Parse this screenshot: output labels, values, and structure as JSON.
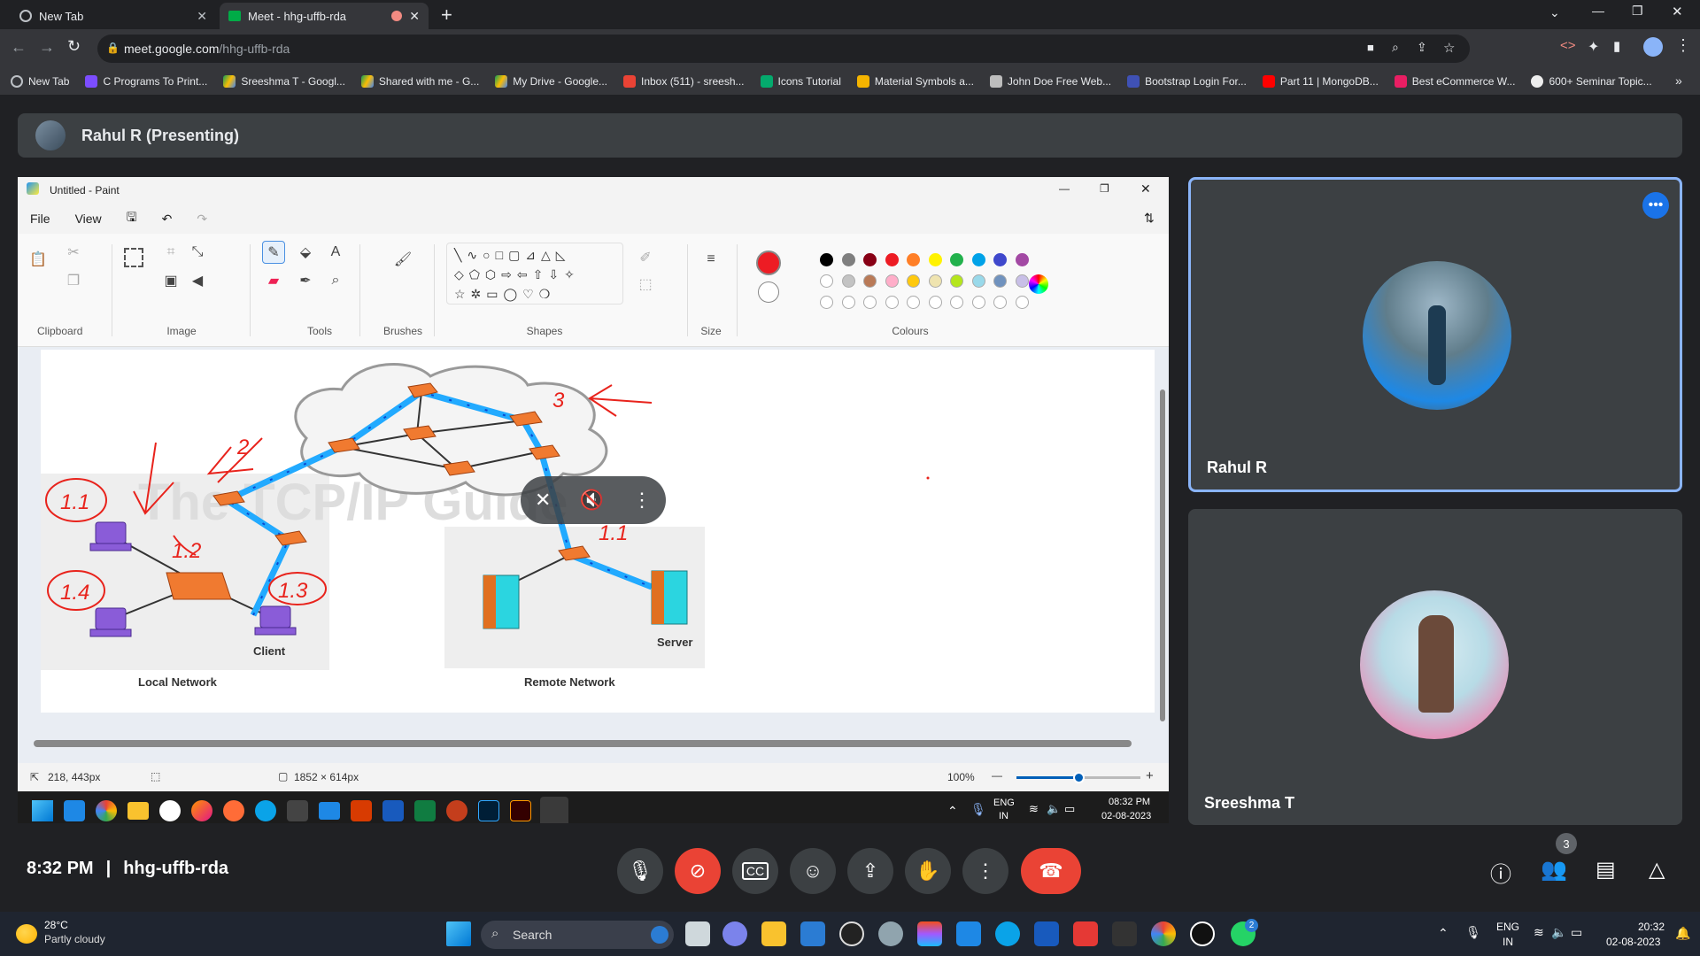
{
  "browser": {
    "tabs": [
      {
        "title": "New Tab",
        "active": false
      },
      {
        "title": "Meet - hhg-uffb-rda",
        "active": true
      }
    ],
    "url_host": "meet.google.com",
    "url_path": "/hhg-uffb-rda",
    "bookmarks": [
      "New Tab",
      "C Programs To Print...",
      "Sreeshma T - Googl...",
      "Shared with me - G...",
      "My Drive - Google...",
      "Inbox (511) - sreesh...",
      "Icons Tutorial",
      "Material Symbols a...",
      "John Doe Free Web...",
      "Bootstrap Login For...",
      "Part 11 | MongoDB...",
      "Best eCommerce W...",
      "600+ Seminar Topic..."
    ],
    "more_bookmarks": "»"
  },
  "meet": {
    "presenter_label": "Rahul R (Presenting)",
    "time": "8:32 PM",
    "divider": "|",
    "meeting_code": "hhg-uffb-rda",
    "participant_count": "3",
    "tiles": [
      {
        "name": "Rahul R",
        "active": true
      },
      {
        "name": "Sreeshma T",
        "active": false
      }
    ],
    "colors": {
      "end_call": "#ea4335",
      "cam_off": "#ea4335",
      "active_border": "#8ab4f8",
      "accent": "#1a73e8"
    }
  },
  "paint": {
    "title": "Untitled - Paint",
    "menu": [
      "File",
      "View"
    ],
    "groups": [
      "Clipboard",
      "Image",
      "Tools",
      "Brushes",
      "Shapes",
      "Size",
      "Colours"
    ],
    "status_pos": "218, 443px",
    "status_dims": "1852 × 614px",
    "zoom": "100%",
    "zoom_level": 0.5,
    "palette_row1": [
      "#000000",
      "#7f7f7f",
      "#880015",
      "#ed1c24",
      "#ff7f27",
      "#fff200",
      "#22b14c",
      "#00a2e8",
      "#3f48cc",
      "#a349a4"
    ],
    "palette_row2": [
      "#ffffff",
      "#c3c3c3",
      "#b97a57",
      "#ffaec9",
      "#ffc90e",
      "#efe4b0",
      "#b5e61d",
      "#99d9ea",
      "#7092be",
      "#c8bfe7"
    ],
    "primary_color": "#ed1c24"
  },
  "diagram": {
    "watermark": "The TCP/IP Guide",
    "labels": {
      "client": "Client",
      "server": "Server",
      "local": "Local Network",
      "remote": "Remote Network"
    },
    "annotations": [
      "1.1",
      "1.2",
      "1.3",
      "1.4",
      "2",
      "3",
      "1.1"
    ]
  },
  "inner_taskbar": {
    "lang1": "ENG",
    "lang2": "IN",
    "time": "08:32 PM",
    "date": "02-08-2023"
  },
  "win_taskbar": {
    "temp": "28°C",
    "weather": "Partly cloudy",
    "search_placeholder": "Search",
    "lang1": "ENG",
    "lang2": "IN",
    "time": "20:32",
    "date": "02-08-2023",
    "notif_badge": "2"
  }
}
